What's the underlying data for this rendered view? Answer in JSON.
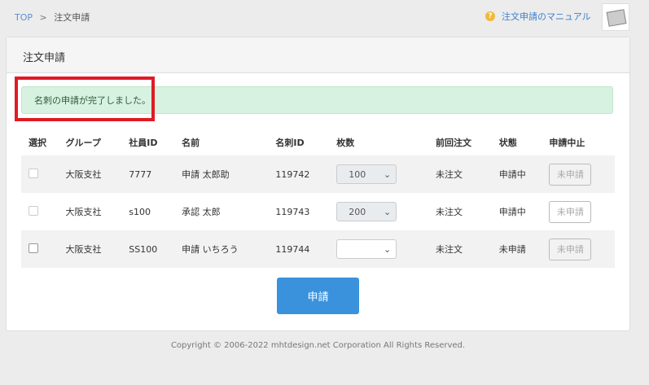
{
  "breadcrumb": {
    "top": "TOP",
    "sep": ">",
    "current": "注文申請"
  },
  "manual_link": "注文申請のマニュアル",
  "panel": {
    "title": "注文申請",
    "alert": "名刺の申請が完了しました。"
  },
  "table": {
    "headers": [
      "選択",
      "グループ",
      "社員ID",
      "名前",
      "名刺ID",
      "枚数",
      "前回注文",
      "状態",
      "申請中止"
    ],
    "rows": [
      {
        "group": "大阪支社",
        "employee_id": "7777",
        "name": "申請 太郎助",
        "card_id": "119742",
        "qty": "100",
        "last_order": "未注文",
        "status": "申請中",
        "cancel": "未申請"
      },
      {
        "group": "大阪支社",
        "employee_id": "s100",
        "name": "承認 太郎",
        "card_id": "119743",
        "qty": "200",
        "last_order": "未注文",
        "status": "申請中",
        "cancel": "未申請"
      },
      {
        "group": "大阪支社",
        "employee_id": "SS100",
        "name": "申請 いちろう",
        "card_id": "119744",
        "qty": "",
        "last_order": "未注文",
        "status": "未申請",
        "cancel": "未申請"
      }
    ]
  },
  "submit": "申請",
  "footer": "Copyright © 2006-2022 mhtdesign.net Corporation All Rights Reserved."
}
